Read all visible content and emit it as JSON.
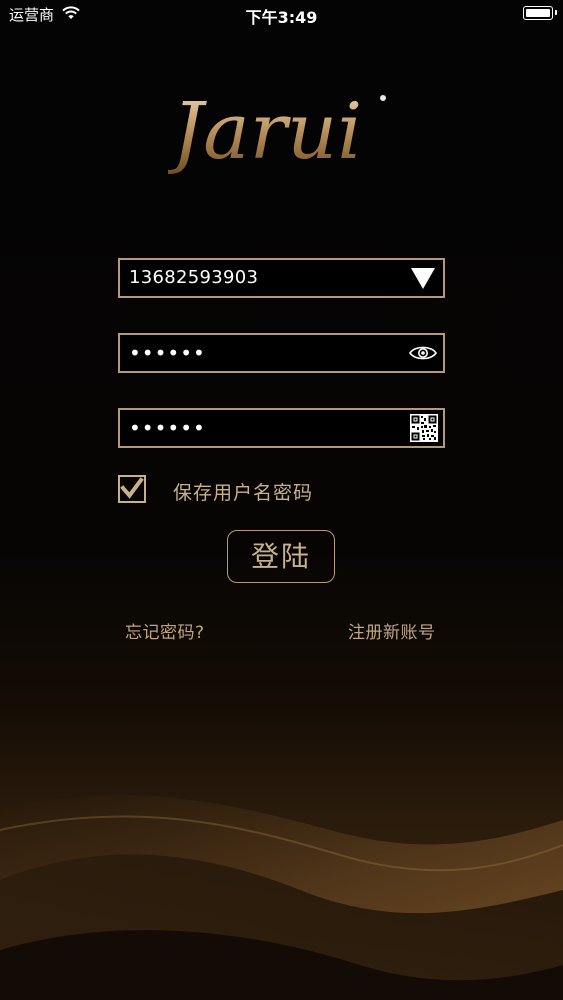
{
  "status_bar": {
    "carrier": "运营商",
    "time": "下午3:49",
    "battery_level": 1.0
  },
  "logo": {
    "text": "Jarui"
  },
  "form": {
    "username": {
      "value": "13682593903",
      "icon": "chevron-down-icon"
    },
    "password": {
      "value": "••••••",
      "icon": "eye-icon"
    },
    "verification": {
      "value": "••••••",
      "icon": "qr-code-icon"
    },
    "remember": {
      "label": "保存用户名密码",
      "checked": true
    },
    "login_label": "登陆"
  },
  "links": {
    "forgot_password": "忘记密码?",
    "register": "注册新账号"
  },
  "colors": {
    "accent_gold": "#b49a76",
    "label_gold": "#c9b08c",
    "background": "#000000"
  }
}
